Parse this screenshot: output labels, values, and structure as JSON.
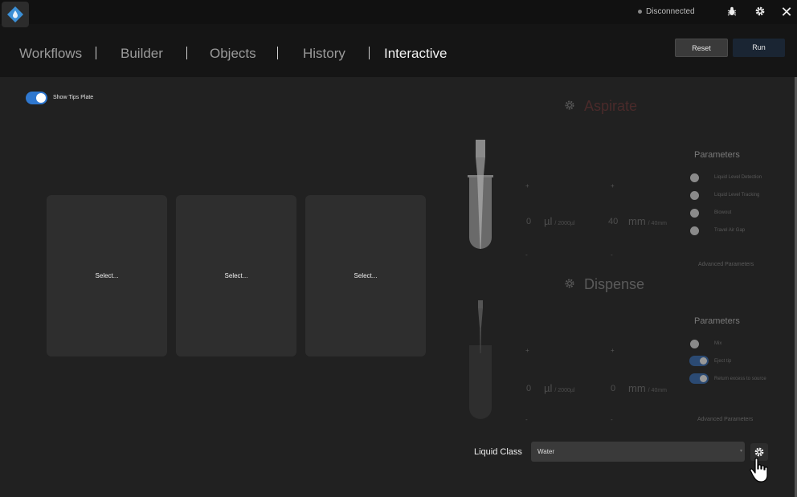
{
  "status": {
    "connection": "Disconnected"
  },
  "nav": {
    "items": [
      "Workflows",
      "Builder",
      "Objects",
      "History",
      "Interactive"
    ],
    "active": "Interactive",
    "reset_label": "Reset",
    "run_label": "Run"
  },
  "tips_plate": {
    "label": "Show Tips Plate",
    "on": true
  },
  "plates": [
    "Select...",
    "Select...",
    "Select..."
  ],
  "aspirate": {
    "title": "Aspirate",
    "plus": "+",
    "minus": "-",
    "volume": "0",
    "volume_unit": "µl",
    "volume_max": "/ 2000µl",
    "height": "40",
    "height_unit": "mm",
    "height_max": "/ 40mm",
    "params_title": "Parameters",
    "options": [
      {
        "label": "Liquid Level Detection",
        "on": false
      },
      {
        "label": "Liquid Level Tracking",
        "on": false
      },
      {
        "label": "Blowout",
        "on": false
      },
      {
        "label": "Travel Air Gap",
        "on": false
      }
    ],
    "advanced": "Advanced Parameters"
  },
  "dispense": {
    "title": "Dispense",
    "plus": "+",
    "minus": "-",
    "volume": "0",
    "volume_unit": "µl",
    "volume_max": "/ 2000µl",
    "height": "0",
    "height_unit": "mm",
    "height_max": "/ 40mm",
    "params_title": "Parameters",
    "options": [
      {
        "label": "Mix",
        "on": false
      },
      {
        "label": "Eject tip",
        "on": true
      },
      {
        "label": "Return excess to source",
        "on": true
      }
    ],
    "advanced": "Advanced Parameters"
  },
  "liquid_class": {
    "label": "Liquid Class",
    "value": "Water"
  },
  "colors": {
    "accent": "#2f78d0",
    "run_button": "#1a2533",
    "background": "#212121"
  }
}
